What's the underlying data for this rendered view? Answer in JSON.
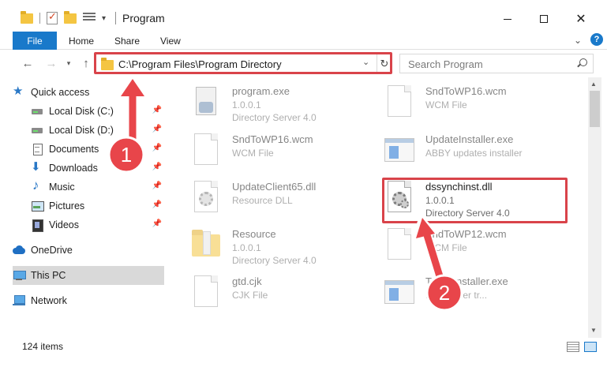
{
  "window": {
    "title": "Program",
    "min_label": "",
    "max_label": "",
    "close_label": "✕"
  },
  "ribbon": {
    "tabs": [
      "File",
      "Home",
      "Share",
      "View"
    ]
  },
  "navigation": {
    "address": "C:\\Program Files\\Program Directory",
    "search_placeholder": "Search Program"
  },
  "sidebar": {
    "items": [
      {
        "label": "Quick access",
        "icon": "star-icon"
      },
      {
        "label": "Local Disk (C:)",
        "icon": "disk-icon",
        "pinned": true
      },
      {
        "label": "Local Disk (D:)",
        "icon": "disk-icon",
        "pinned": true
      },
      {
        "label": "Documents",
        "icon": "document-icon",
        "pinned": true
      },
      {
        "label": "Downloads",
        "icon": "download-icon",
        "pinned": true
      },
      {
        "label": "Music",
        "icon": "music-icon",
        "pinned": true
      },
      {
        "label": "Pictures",
        "icon": "pictures-icon",
        "pinned": true
      },
      {
        "label": "Videos",
        "icon": "videos-icon",
        "pinned": true
      },
      {
        "label": "OneDrive",
        "icon": "cloud-icon"
      },
      {
        "label": "This PC",
        "icon": "computer-icon",
        "selected": true
      },
      {
        "label": "Network",
        "icon": "network-icon"
      }
    ]
  },
  "files": [
    {
      "name": "program.exe",
      "line2": "1.0.0.1",
      "line3": "Directory Server 4.0",
      "icon": "program-icon"
    },
    {
      "name": "SndToWP16.wcm",
      "line2": "WCM File",
      "line3": "",
      "icon": "file-icon"
    },
    {
      "name": "SndToWP16.wcm",
      "line2": "WCM File",
      "line3": "",
      "icon": "file-icon"
    },
    {
      "name": "UpdateInstaller.exe",
      "line2": "ABBY updates installer",
      "line3": "",
      "icon": "exe-icon"
    },
    {
      "name": "UpdateClient65.dll",
      "line2": "Resource DLL",
      "line3": "",
      "icon": "dll-icon"
    },
    {
      "name": "dssynchinst.dll",
      "line2": "1.0.0.1",
      "line3": "Directory Server 4.0",
      "icon": "dll-icon"
    },
    {
      "name": "Resource",
      "line2": "1.0.0.1",
      "line3": "Directory Server 4.0",
      "icon": "folder-icon"
    },
    {
      "name": "SndToWP12.wcm",
      "line2": "WCM File",
      "line3": "",
      "icon": "file-icon"
    },
    {
      "name": "gtd.cjk",
      "line2": "CJK File",
      "line3": "",
      "icon": "file-icon"
    },
    {
      "name": "TermsInstaller.exe",
      "line2": "Finereader tr...",
      "line3": "",
      "icon": "exe-icon"
    }
  ],
  "status": {
    "item_count": "124 items"
  },
  "annotations": {
    "badge_1": "1",
    "badge_2": "2"
  },
  "colors": {
    "accent": "#1979ca",
    "highlight": "#d9434a",
    "folder": "#f4c542"
  }
}
